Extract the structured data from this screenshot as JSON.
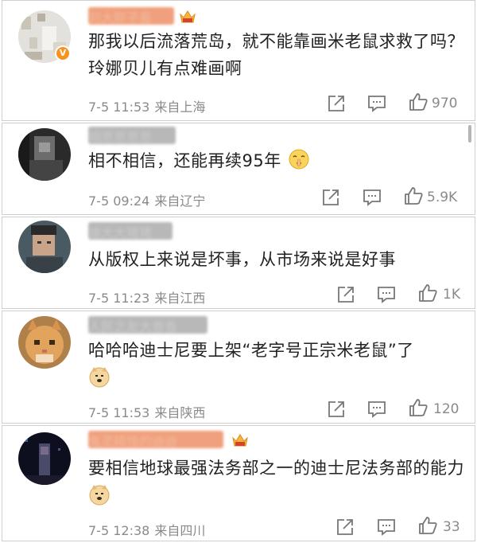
{
  "comments": [
    {
      "username": "刘大胖子喜",
      "has_vip_badge": true,
      "has_crown": true,
      "text": "那我以后流落荒岛，就不能靠画米老鼠求救了吗？玲娜贝儿有点难画啊",
      "date": "7-5 11:53",
      "location": "来自上海",
      "likes": "970"
    },
    {
      "username": "相思思思思",
      "has_vip_badge": false,
      "has_crown": false,
      "text": "相不相信，还能再续95年",
      "emoji": "shush-face",
      "date": "7-5 09:24",
      "location": "来自辽宁",
      "likes": "5.9K"
    },
    {
      "username": "迪大大猪猪",
      "has_vip_badge": false,
      "has_crown": false,
      "text": "从版权上来说是坏事，从市场来说是好事",
      "date": "7-5 11:23",
      "location": "来自江西",
      "likes": "1K"
    },
    {
      "username": "人民之友大香香",
      "has_vip_badge": false,
      "has_crown": false,
      "text": "哈哈哈迪士尼要上架“老字号正宗米老鼠”了",
      "emoji": "doge",
      "date": "7-5 11:53",
      "location": "来自陕西",
      "likes": "120"
    },
    {
      "username": "鬼灵精怪的迪迪",
      "has_vip_badge": false,
      "has_crown": true,
      "text": "要相信地球最强法务部之一的迪士尼法务部的能力",
      "emoji": "doge",
      "date": "7-5 12:38",
      "location": "来自四川",
      "likes": "33"
    }
  ],
  "icons": {
    "share": "share-icon",
    "comment": "comment-icon",
    "like": "like-icon"
  },
  "colors": {
    "text": "#222222",
    "meta": "#8a8a8a",
    "username_blur": "#e8906a",
    "vip_badge": "#f7931e"
  }
}
